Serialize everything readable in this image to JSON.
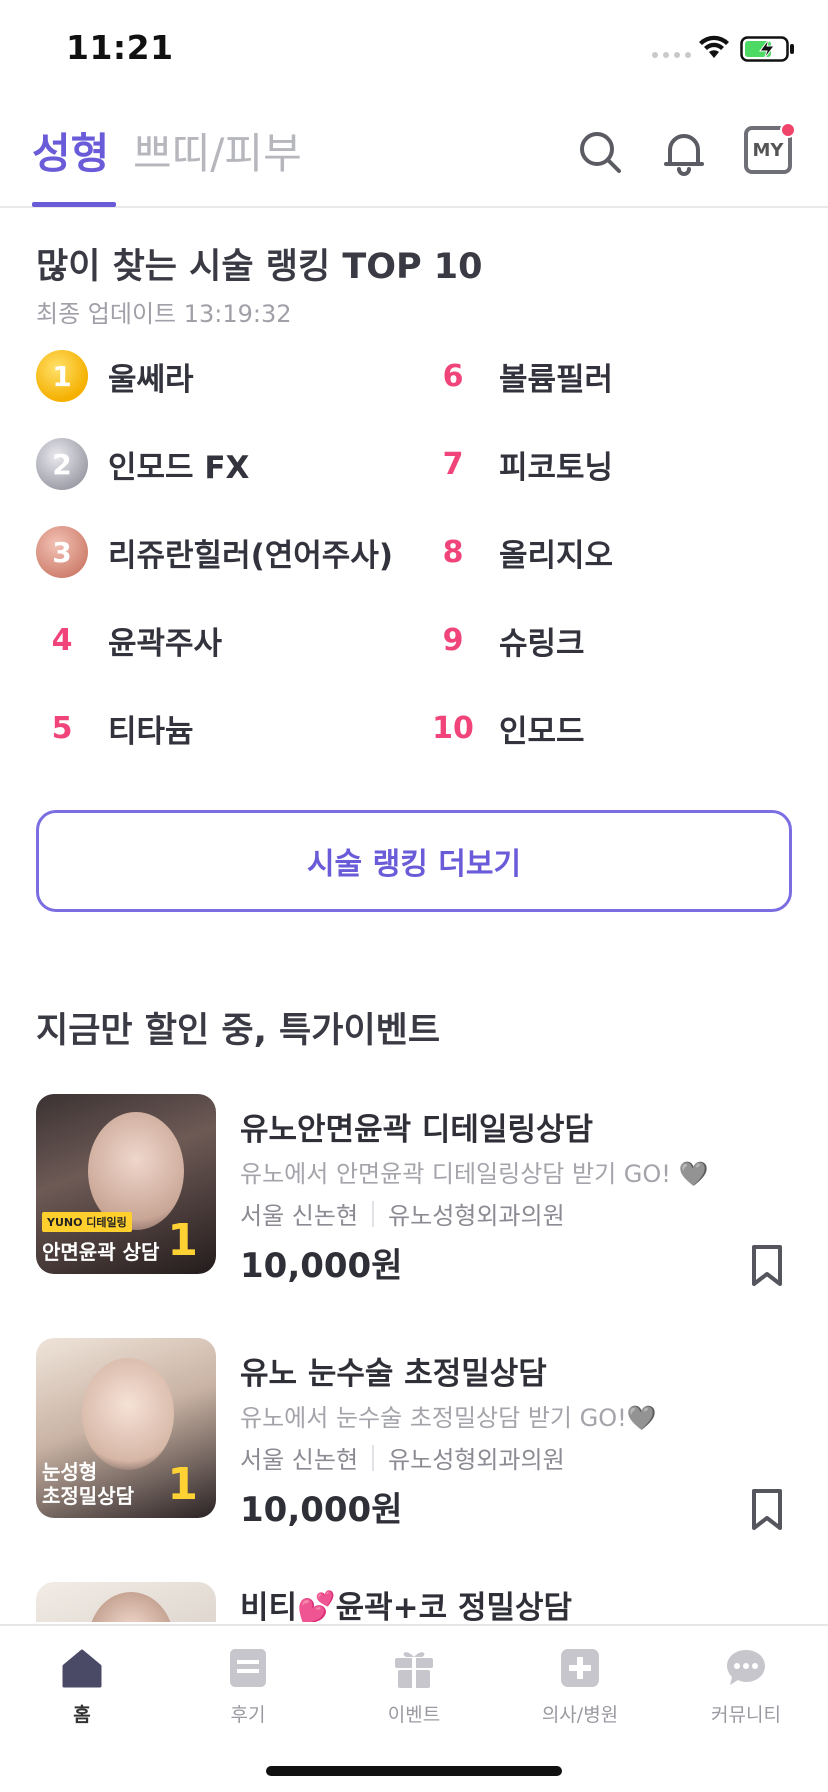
{
  "status_bar": {
    "time": "11:21"
  },
  "header": {
    "tab_active": "성형",
    "tab_inactive": "쁘띠/피부",
    "my_label": "MY"
  },
  "ranking": {
    "title": "많이 찾는 시술 랭킹 TOP 10",
    "updated": "최종 업데이트 13:19:32",
    "items": [
      {
        "rank": "1",
        "label": "울쎄라"
      },
      {
        "rank": "2",
        "label": "인모드 FX"
      },
      {
        "rank": "3",
        "label": "리쥬란힐러(연어주사)"
      },
      {
        "rank": "4",
        "label": "윤곽주사"
      },
      {
        "rank": "5",
        "label": "티타늄"
      },
      {
        "rank": "6",
        "label": "볼륨필러"
      },
      {
        "rank": "7",
        "label": "피코토닝"
      },
      {
        "rank": "8",
        "label": "올리지오"
      },
      {
        "rank": "9",
        "label": "슈링크"
      },
      {
        "rank": "10",
        "label": "인모드"
      }
    ],
    "more_label": "시술 랭킹 더보기"
  },
  "events": {
    "title": "지금만 할인 중, 특가이벤트",
    "items": [
      {
        "title": "유노안면윤곽 디테일링상담",
        "desc": "유노에서 안면윤곽 디테일링상담 받기 GO! 🩶",
        "region": "서울 신논현",
        "clinic": "유노성형외과의원",
        "price": "10,000원",
        "thumb_tag": "YUNO 디테일링",
        "thumb_caption": "안면윤곽 상담",
        "thumb_big": "1"
      },
      {
        "title": "유노 눈수술 초정밀상담",
        "desc": "유노에서 눈수술 초정밀상담 받기 GO!🩶",
        "region": "서울 신논현",
        "clinic": "유노성형외과의원",
        "price": "10,000원",
        "thumb_caption": "눈성형\n초정밀상담",
        "thumb_big": "1"
      },
      {
        "title": "비티💕윤곽+코 정밀상담"
      }
    ]
  },
  "tabbar": {
    "items": [
      {
        "label": "홈",
        "icon": "home-icon"
      },
      {
        "label": "후기",
        "icon": "review-icon"
      },
      {
        "label": "이벤트",
        "icon": "gift-icon"
      },
      {
        "label": "의사/병원",
        "icon": "hospital-icon"
      },
      {
        "label": "커뮤니티",
        "icon": "chat-icon"
      }
    ]
  },
  "colors": {
    "accent": "#6a5bd9",
    "rank_pink": "#f0447a",
    "notification_dot": "#f0446a"
  }
}
